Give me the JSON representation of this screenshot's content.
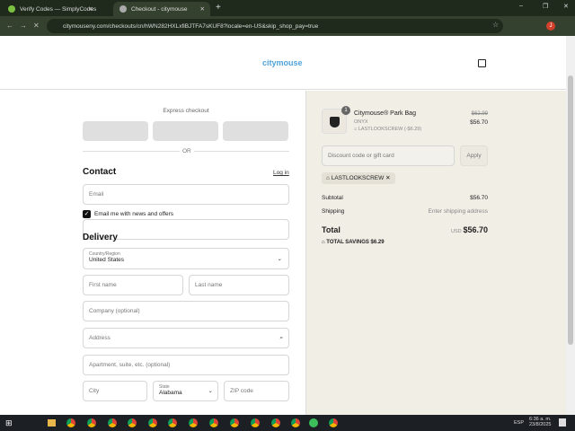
{
  "browser": {
    "tabs": [
      {
        "title": "Verify Codes — SimplyCodes"
      },
      {
        "title": "Checkout - citymouse"
      }
    ],
    "url": "citymouseny.com/checkouts/cn/hWN282HXLxfiBJTFA7sKUF8?locale=en-US&skip_shop_pay=true",
    "profile_initial": "J"
  },
  "header": {
    "logo": "citymouse"
  },
  "checkout": {
    "express_label": "Express checkout",
    "or_label": "OR",
    "contact": {
      "title": "Contact",
      "login": "Log in",
      "email_placeholder": "Email",
      "newsletter": "Email me with news and offers",
      "newsletter_checked": true
    },
    "delivery": {
      "title": "Delivery",
      "country_label": "Country/Region",
      "country": "United States",
      "first_name": "First name",
      "last_name": "Last name",
      "company": "Company (optional)",
      "address": "Address",
      "apartment": "Apartment, suite, etc. (optional)",
      "city": "City",
      "state_label": "State",
      "state": "Alabama",
      "zip": "ZIP code"
    }
  },
  "summary": {
    "item": {
      "name": "Citymouse® Park Bag",
      "variant": "ONYX",
      "discount": "LASTLOOKSCREW (-$6.29)",
      "quantity": "1",
      "original_price": "$62.99",
      "price": "$56.70"
    },
    "discount_placeholder": "Discount code or gift card",
    "apply": "Apply",
    "applied_code": "LASTLOOKSCREW",
    "subtotal_label": "Subtotal",
    "subtotal": "$56.70",
    "shipping_label": "Shipping",
    "shipping": "Enter shipping address",
    "total_label": "Total",
    "currency": "USD",
    "total": "$56.70",
    "savings_label": "TOTAL SAVINGS",
    "savings": "$6.29"
  },
  "taskbar": {
    "time": "6:36 a. m.",
    "date": "23/8/2025",
    "lang": "ESP"
  }
}
